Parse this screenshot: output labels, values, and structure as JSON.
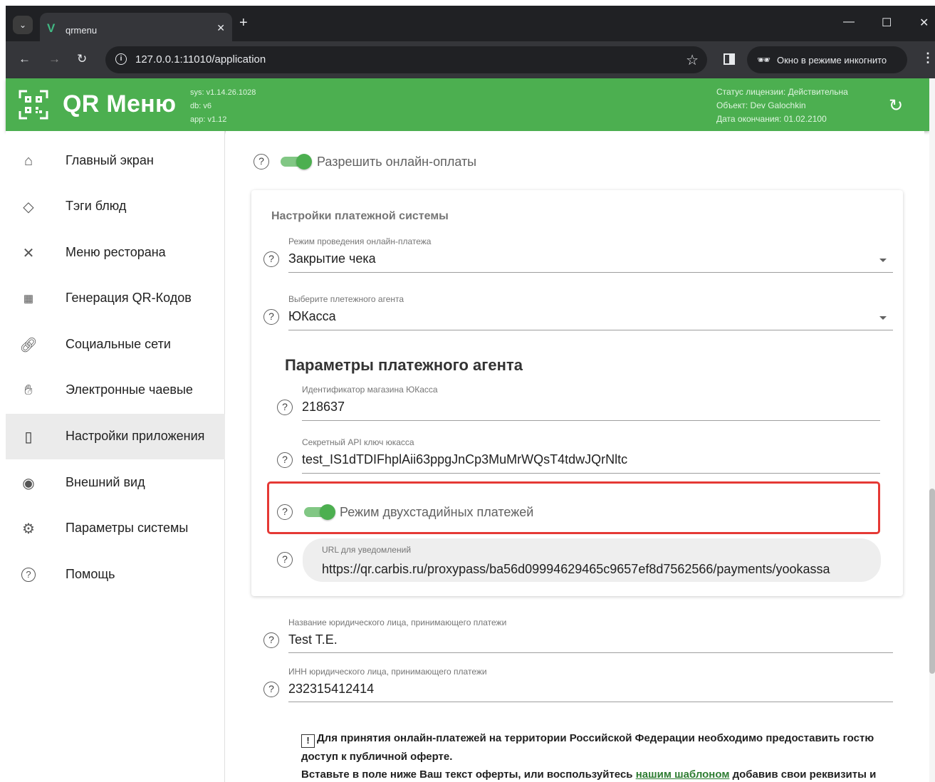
{
  "browser": {
    "tab_title": "qrmenu",
    "tab_favicon": "V",
    "url": "127.0.0.1:11010/application",
    "incognito_label": "Окно в режиме инкогнито"
  },
  "header": {
    "brand": "QR Меню",
    "versions": [
      "sys: v1.14.26.1028",
      "db: v6",
      "app: v1.12"
    ],
    "license": [
      "Статус лицензии: Действительна",
      "Объект: Dev Galochkin",
      "Дата окончания: 01.02.2100"
    ],
    "accent_color": "#4caf50"
  },
  "sidebar": {
    "items": [
      {
        "label": "Главный экран",
        "icon": "home-icon"
      },
      {
        "label": "Тэги блюд",
        "icon": "tag-icon"
      },
      {
        "label": "Меню ресторана",
        "icon": "cutlery-icon"
      },
      {
        "label": "Генерация QR-Кодов",
        "icon": "qr-code-icon"
      },
      {
        "label": "Социальные сети",
        "icon": "link-icon"
      },
      {
        "label": "Электронные чаевые",
        "icon": "tips-hand-icon"
      },
      {
        "label": "Настройки приложения",
        "icon": "phone-settings-icon",
        "active": true
      },
      {
        "label": "Внешний вид",
        "icon": "eye-icon"
      },
      {
        "label": "Параметры системы",
        "icon": "gear-icon"
      },
      {
        "label": "Помощь",
        "icon": "help-circle-icon"
      }
    ]
  },
  "main": {
    "allow_online_payments": {
      "label": "Разрешить онлайн-оплаты",
      "enabled": true
    },
    "payment_system": {
      "title": "Настройки платежной системы",
      "mode": {
        "label": "Режим проведения онлайн-платежа",
        "value": "Закрытие чека"
      },
      "agent": {
        "label": "Выберите плетежного агента",
        "value": "ЮКасса"
      },
      "agent_params": {
        "title": "Параметры платежного агента",
        "shop_id": {
          "label": "Идентификатор магазина ЮКасса",
          "value": "218637"
        },
        "api_key": {
          "label": "Секретный API ключ юкасса",
          "value": "test_IS1dTDIFhplAii63ppgJnCp3MuMrWQsT4tdwJQrNltc"
        },
        "two_stage": {
          "label": "Режим двухстадийных платежей",
          "enabled": true
        },
        "notify_url": {
          "label": "URL для уведомлений",
          "value": "https://qr.carbis.ru/proxypass/ba56d09994629465c9657ef8d7562566/payments/yookassa"
        }
      }
    },
    "legal_name": {
      "label": "Название юридического лица, принимающего платежи",
      "value": "Test T.E."
    },
    "legal_inn": {
      "label": "ИНН юридического лица, принимающего платежи",
      "value": "232315412414"
    },
    "notice": {
      "icon": "!",
      "line1": "Для принятия онлайн-платежей на территории Российской Федерации необходимо предоставить гостю доступ к публичной оферте.",
      "line2_before": "Вставьте в поле ниже Ваш текст оферты, или воспользуйтесь",
      "link": "нашим шаблоном",
      "line2_after": "добавив свои реквизиты и"
    }
  }
}
